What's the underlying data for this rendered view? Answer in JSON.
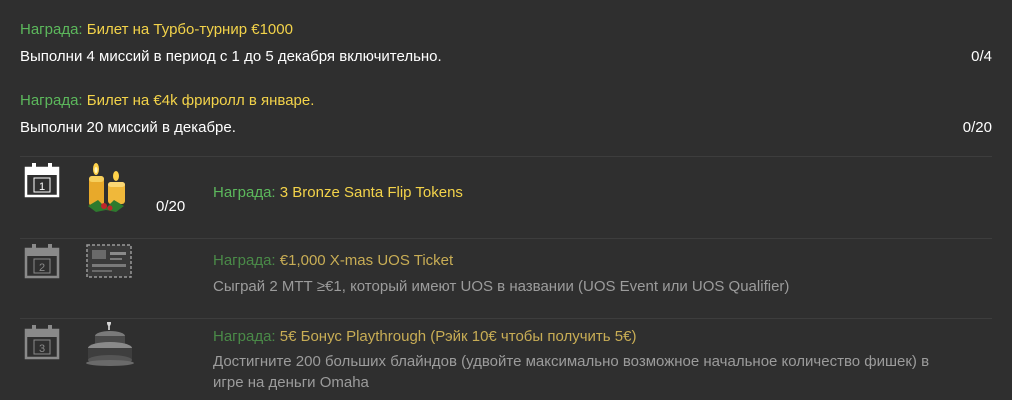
{
  "reward_label": "Награда:",
  "top_rewards": [
    {
      "prize": "Билет на Турбо-турнир €1000",
      "description": "Выполни 4 миссий в период с 1 до 5 декабря включительно.",
      "progress": "0/4"
    },
    {
      "prize": "Билет на €4k фриролл в январе.",
      "description": "Выполни 20 миссий в декабре.",
      "progress": "0/20"
    }
  ],
  "missions": [
    {
      "day": "1",
      "icon": "candles-icon",
      "progress": "0/20",
      "prize": "3 Bronze Santa Flip Tokens",
      "description": "",
      "active": true
    },
    {
      "day": "2",
      "icon": "ticket-icon",
      "prize": "€1,000 X-mas UOS Ticket",
      "description": "Сыграй 2 МТТ ≥€1, который имеют UOS в названии (UOS Event или UOS Qualifier)",
      "active": false
    },
    {
      "day": "3",
      "icon": "cake-icon",
      "prize": "5€ Бонус Playthrough (Рэйк 10€ чтобы получить 5€)",
      "description": "Достигните 200 больших блайндов (удвойте максимально возможное начальное количество фишек) в игре на деньги Omaha",
      "active": false
    }
  ],
  "colors": {
    "background": "#2f2f2f",
    "label_green": "#5cb85c",
    "prize_yellow": "#f3d34a",
    "muted_green": "#4a8a48",
    "muted_yellow": "#c8ad55",
    "muted_text": "#9c9c9c"
  }
}
